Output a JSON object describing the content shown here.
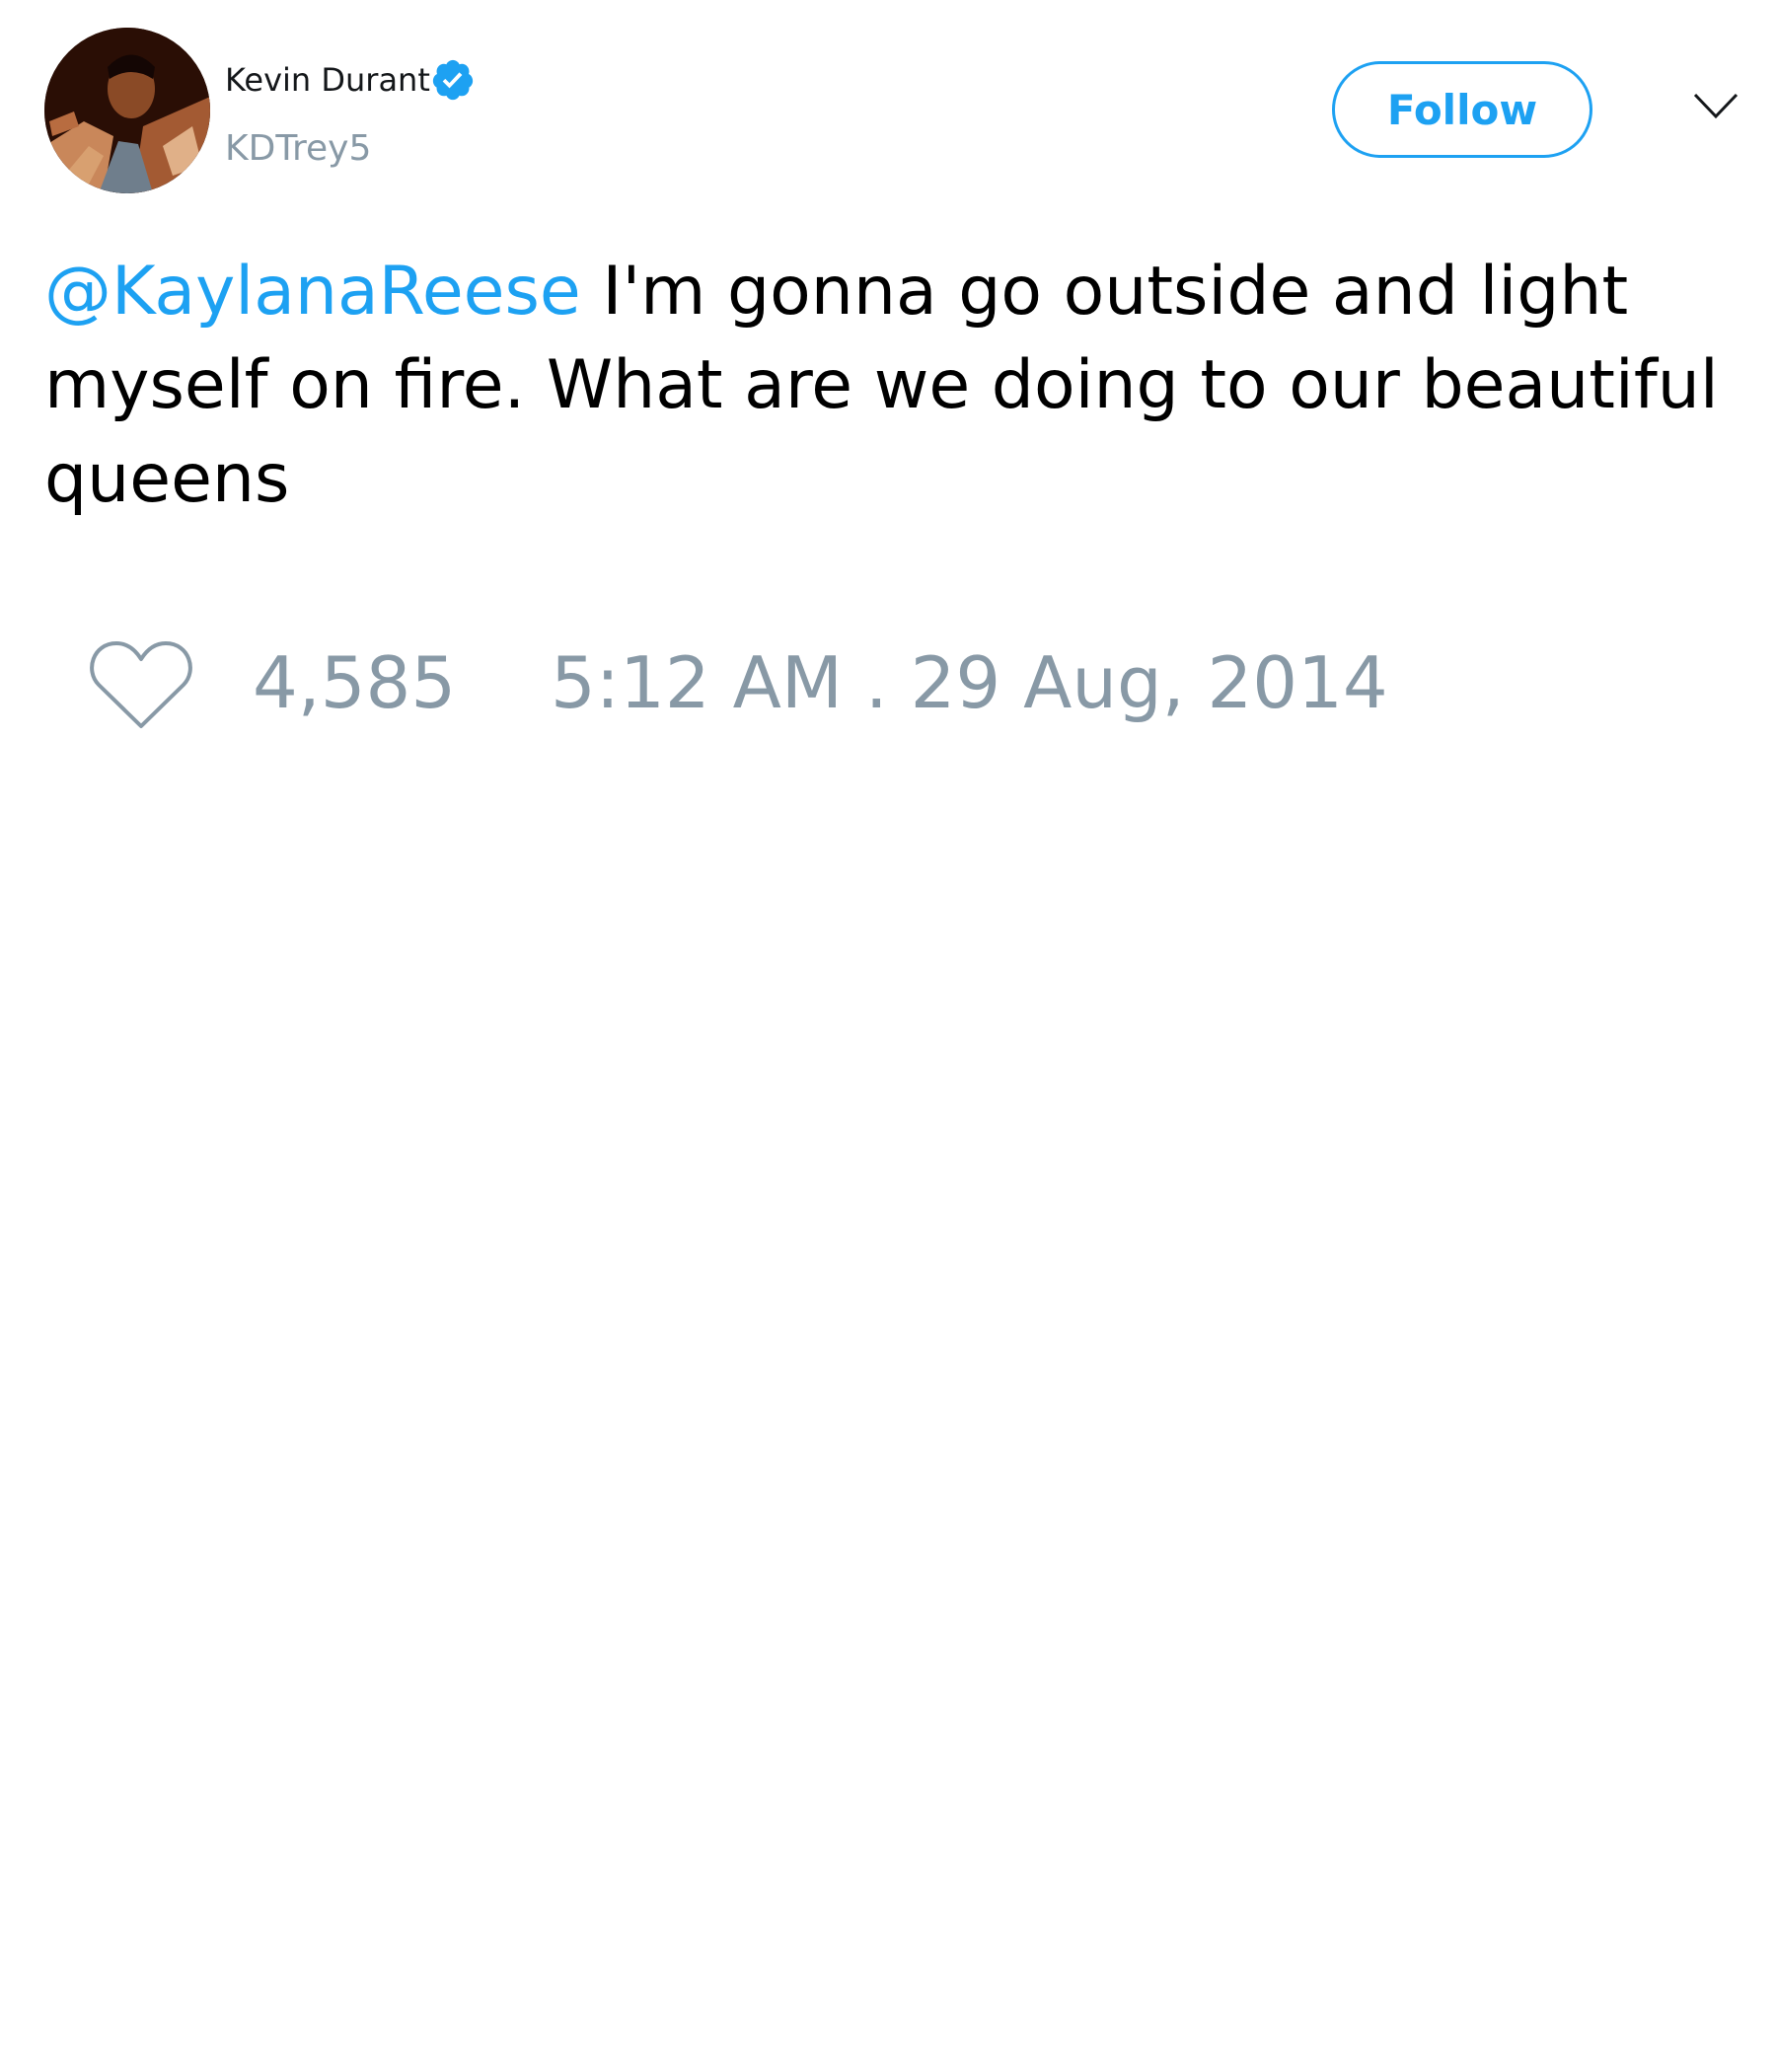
{
  "author": {
    "display_name": "Kevin Durant",
    "handle": "KDTrey5",
    "verified": true,
    "avatar_icon": "profile-photo"
  },
  "header": {
    "follow_label": "Follow",
    "menu_icon": "chevron-down-icon"
  },
  "tweet": {
    "mention": "@KaylanaReese",
    "body": " I'm gonna go outside and light myself on fire. What are we doing to our beautiful queens"
  },
  "footer": {
    "like_icon": "heart-icon",
    "like_count": "4,585",
    "timestamp": "5:12 AM . 29 Aug, 2014"
  },
  "colors": {
    "accent": "#1da1f2",
    "muted": "#8899a6",
    "text": "#000000"
  }
}
